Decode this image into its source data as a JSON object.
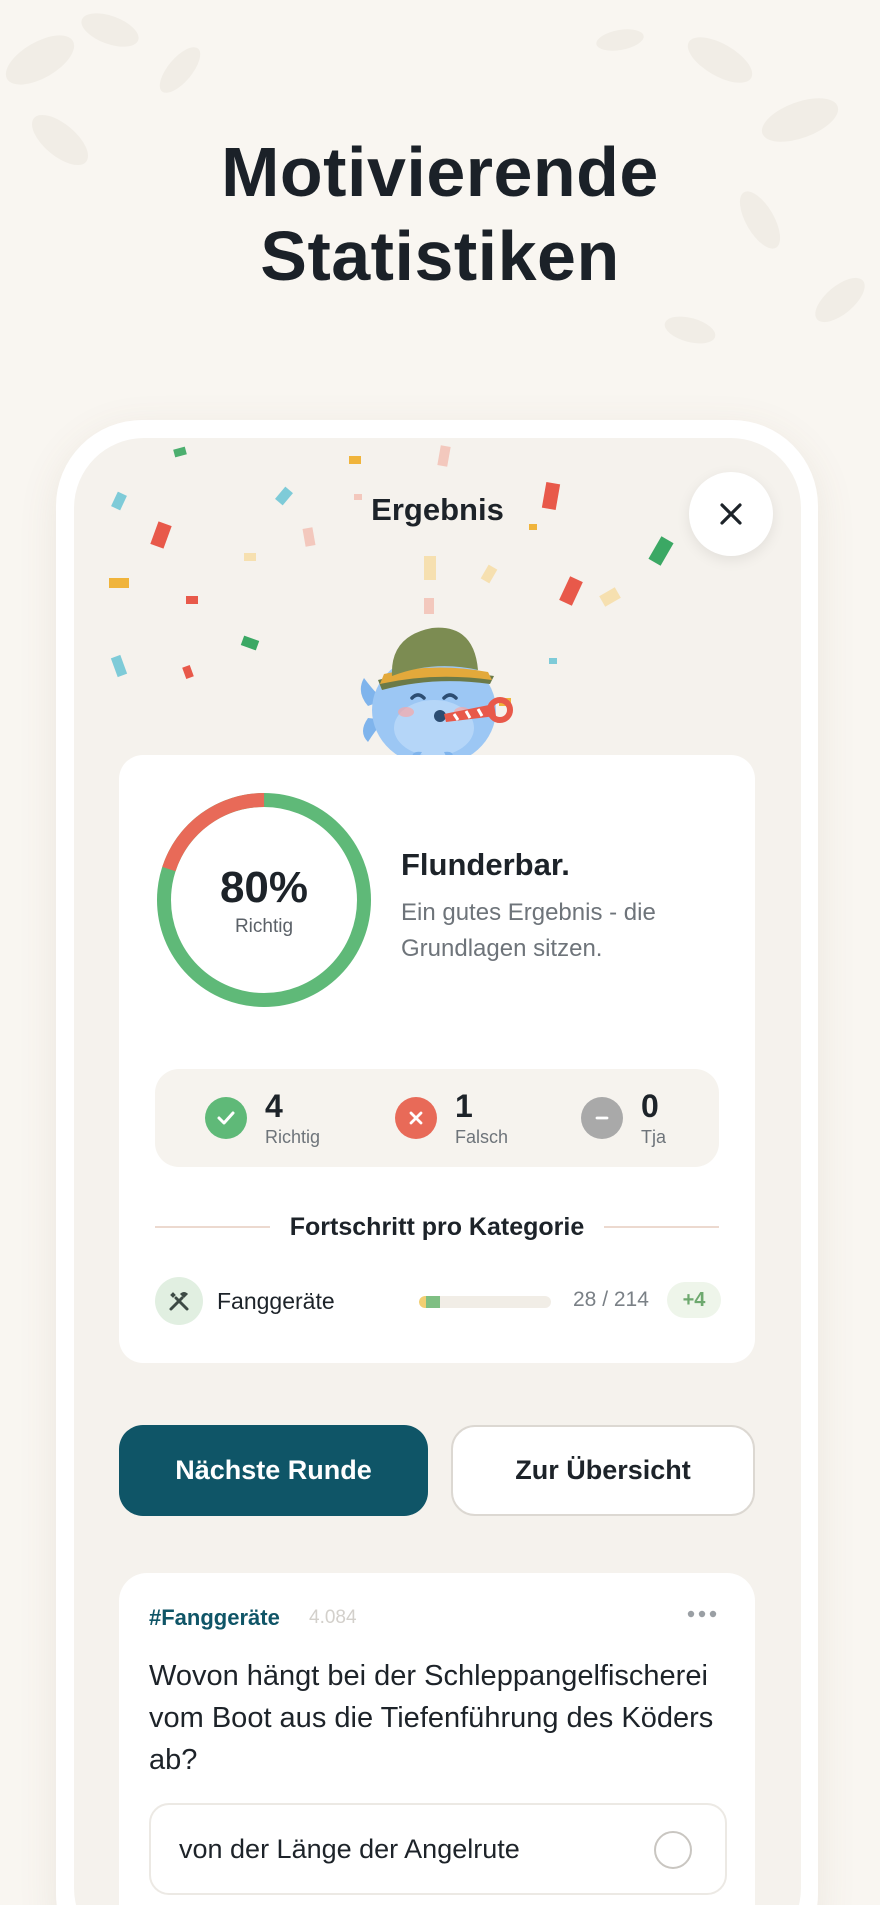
{
  "headline": [
    "Motivierende",
    "Statistiken"
  ],
  "screen": {
    "title": "Ergebnis",
    "close_icon": "close-icon"
  },
  "result": {
    "percent": "80%",
    "percent_label": "Richtig",
    "correct_fraction": 0.8,
    "verdict_title": "Flunderbar.",
    "verdict_text": "Ein gutes Ergebnis - die Grundlagen sitzen.",
    "colors": {
      "correct": "#5fb978",
      "wrong": "#e86a58"
    }
  },
  "stats": [
    {
      "value": "4",
      "label": "Richtig",
      "icon": "check-icon",
      "color": "#5fb978"
    },
    {
      "value": "1",
      "label": "Falsch",
      "icon": "cross-icon",
      "color": "#e86a58"
    },
    {
      "value": "0",
      "label": "Tja",
      "icon": "minus-icon",
      "color": "#a9a9a9"
    }
  ],
  "progress": {
    "title": "Fortschritt pro Kategorie",
    "categories": [
      {
        "name": "Fanggeräte",
        "icon": "tools-icon",
        "count": "28 / 214",
        "delta": "+4",
        "base_fraction": 0.112,
        "new_fraction": 0.019
      }
    ]
  },
  "buttons": {
    "next": "Nächste Runde",
    "overview": "Zur Übersicht"
  },
  "question": {
    "tag": "#Fanggeräte",
    "views": "4.084",
    "more_icon": "more-icon",
    "text": "Wovon hängt bei der Schleppangelfischerei vom Boot aus die Tiefenführung des Köders ab?",
    "answers": [
      "von der Länge der Angelrute"
    ]
  },
  "theme": {
    "primary": "#0f5567",
    "background": "#f9f6f1"
  }
}
